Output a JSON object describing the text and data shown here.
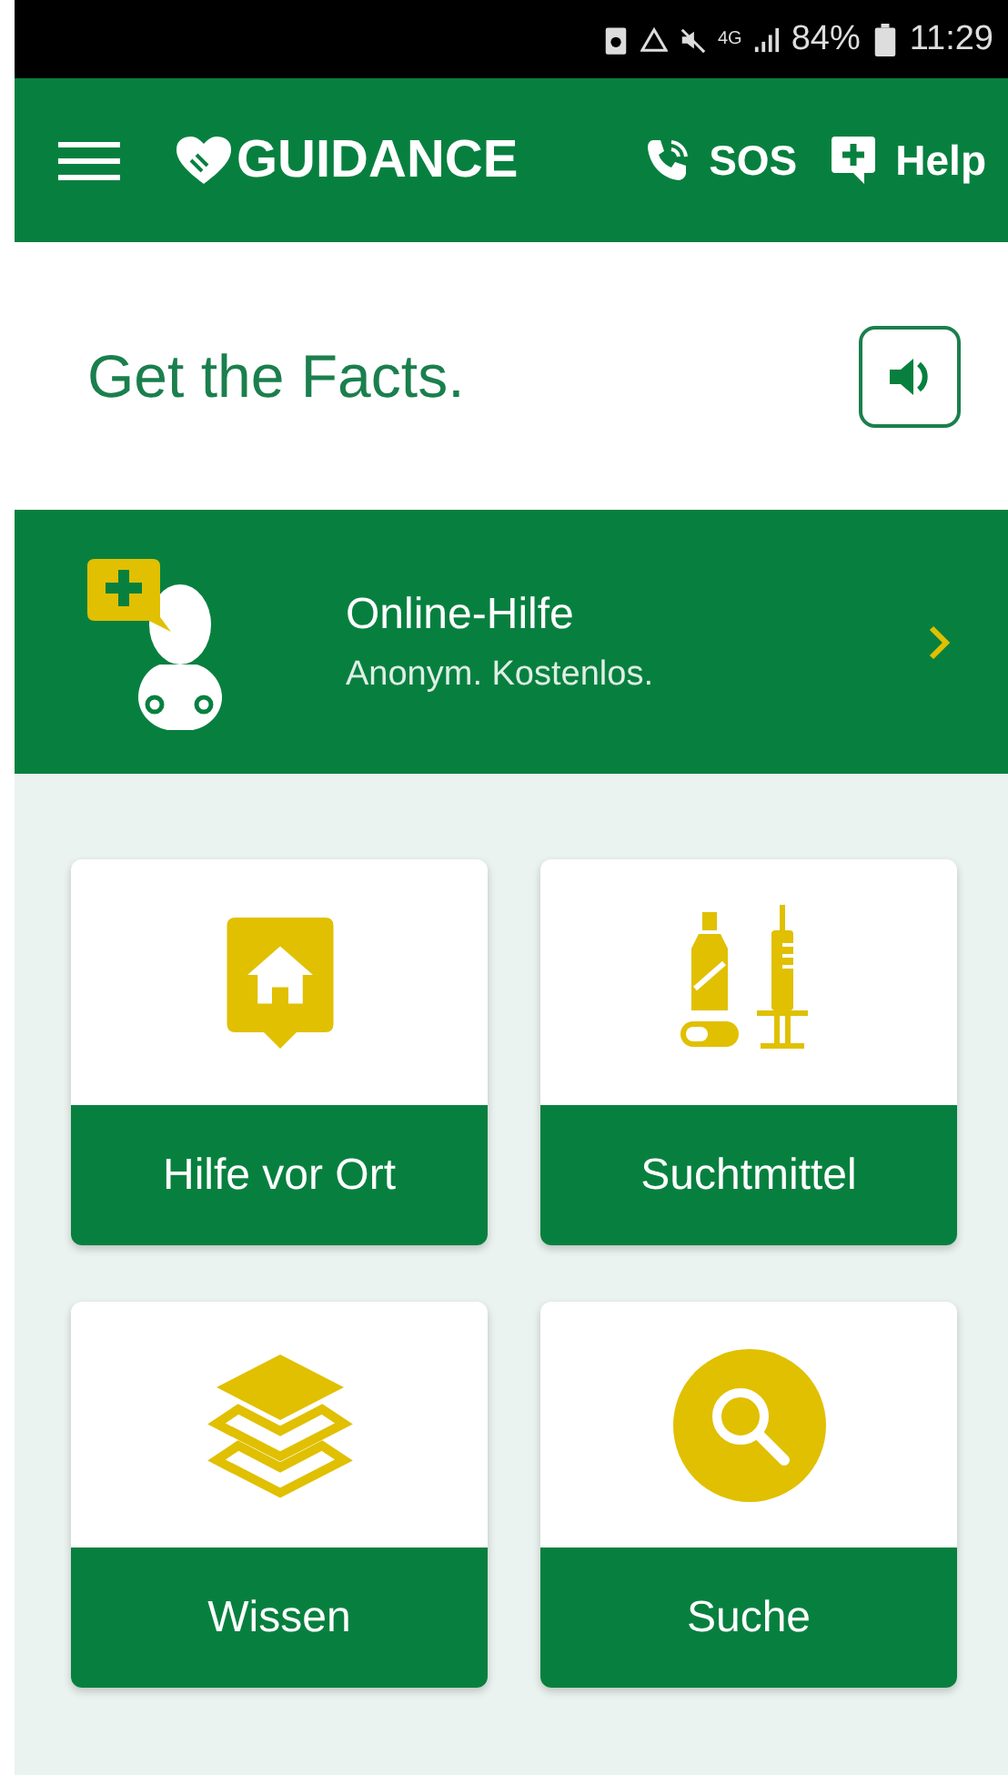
{
  "status_bar": {
    "network": "4G",
    "battery": "84%",
    "time": "11:29"
  },
  "header": {
    "logo": "GUIDANCE",
    "actions": [
      {
        "kind": "phone",
        "label": "SOS"
      },
      {
        "kind": "help",
        "label": "Help"
      }
    ]
  },
  "tagline": "Get the Facts.",
  "banner": {
    "title": "Online-Hilfe",
    "subtitle": "Anonym. Kostenlos."
  },
  "tiles": [
    {
      "kind": "house",
      "label": "Hilfe vor Ort"
    },
    {
      "kind": "substances",
      "label": "Suchtmittel"
    },
    {
      "kind": "layers",
      "label": "Wissen"
    },
    {
      "kind": "search",
      "label": "Suche"
    }
  ]
}
